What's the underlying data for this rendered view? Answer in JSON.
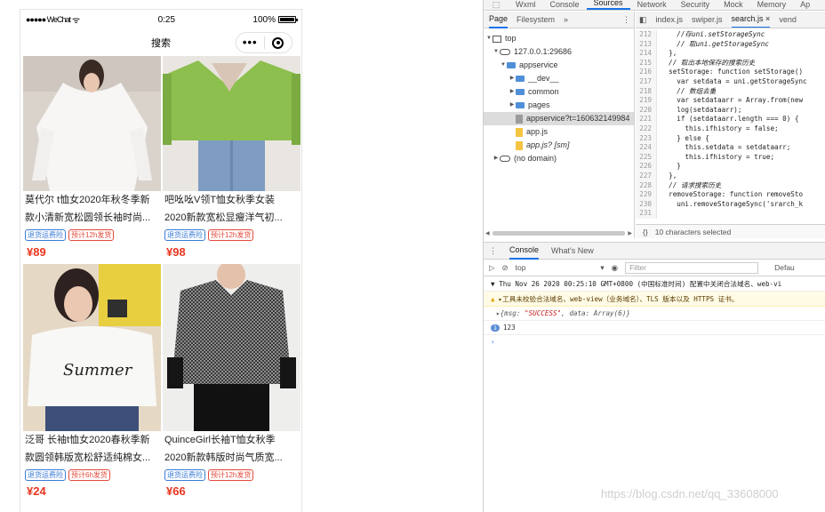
{
  "phone": {
    "status": {
      "carrier": "●●●●● WeChat",
      "wifi": "ᯤ",
      "time": "0:25",
      "battery_pct": "100%",
      "battery_level": 1.0
    },
    "nav_title": "搜索",
    "capsule_more": "•••",
    "products": [
      {
        "line1": "莫代尔 t恤女2020年秋冬季新",
        "line2": "款小清新宽松圆领长袖时尚...",
        "tag1": "退货运费险",
        "tag2": "预计12h发货",
        "price": "¥89",
        "image": "white-long-sleeve-tee"
      },
      {
        "line1": "吧吆吆V领T恤女秋季女装",
        "line2": "2020新款宽松显瘦洋气初...",
        "tag1": "退货运费险",
        "tag2": "预计12h发货",
        "price": "¥98",
        "image": "green-v-neck-top"
      },
      {
        "line1": "泛哥 长袖t恤女2020春秋季新",
        "line2": "款圆领韩版宽松舒适纯棉女...",
        "tag1": "退货运费险",
        "tag2": "预计6h发货",
        "price": "¥24",
        "image": "white-summer-sweatshirt"
      },
      {
        "line1": "QuinceGirl长袖T恤女秋季",
        "line2": "2020新款韩版时尚气质宽...",
        "tag1": "退货运费险",
        "tag2": "预计12h发货",
        "price": "¥66",
        "image": "houndstooth-top"
      }
    ]
  },
  "devtools": {
    "top_tabs": [
      "Wxml",
      "Console",
      "Sources",
      "Network",
      "Security",
      "Mock",
      "Memory",
      "Ap"
    ],
    "active_top_tab": "Sources",
    "nav_tabs": {
      "page": "Page",
      "filesystem": "Filesystem",
      "more": "»",
      "kebab": "⋮"
    },
    "tree": [
      {
        "label": "top",
        "depth": 0,
        "icon": "frame-icon",
        "expanded": true
      },
      {
        "label": "127.0.0.1:29686",
        "depth": 1,
        "icon": "cloud-icon",
        "expanded": true
      },
      {
        "label": "appservice",
        "depth": 2,
        "icon": "folder-icon",
        "expanded": true
      },
      {
        "label": "__dev__",
        "depth": 3,
        "icon": "folder-icon",
        "expanded": false
      },
      {
        "label": "common",
        "depth": 3,
        "icon": "folder-icon",
        "expanded": false
      },
      {
        "label": "pages",
        "depth": 3,
        "icon": "folder-icon",
        "expanded": false
      },
      {
        "label": "appservice?t=160632149984",
        "depth": 3,
        "icon": "file-icon",
        "selected": true
      },
      {
        "label": "app.js",
        "depth": 3,
        "icon": "js-file-icon"
      },
      {
        "label": "app.js? [sm]",
        "depth": 3,
        "icon": "js-file-icon"
      },
      {
        "label": "(no domain)",
        "depth": 0,
        "icon": "cloud-icon",
        "expanded": false
      }
    ],
    "editor_tabs": [
      "index.js",
      "swiper.js",
      "search.js ×",
      "vend"
    ],
    "active_editor_tab": "search.js ×",
    "code_lines": [
      {
        "n": "212",
        "t": "    //存uni.setStorageSync"
      },
      {
        "n": "213",
        "t": "    // 取uni.getStorageSync"
      },
      {
        "n": "214",
        "t": "  },"
      },
      {
        "n": "215",
        "t": "  // 取出本地保存的搜索历史"
      },
      {
        "n": "216",
        "t": "  setStorage: function setStorage()"
      },
      {
        "n": "217",
        "t": "    var setdata = uni.getStorageSync"
      },
      {
        "n": "218",
        "t": "    // 数组去重"
      },
      {
        "n": "219",
        "t": "    var setdataarr = Array.from(new"
      },
      {
        "n": "220",
        "t": "    log(setdataarr);"
      },
      {
        "n": "221",
        "t": "    if (setdataarr.length === 0) {"
      },
      {
        "n": "222",
        "t": "      this.ifhistory = false;"
      },
      {
        "n": "223",
        "t": "    } else {"
      },
      {
        "n": "224",
        "t": "      this.setdata = setdataarr;"
      },
      {
        "n": "225",
        "t": "      this.ifhistory = true;"
      },
      {
        "n": "226",
        "t": "    }"
      },
      {
        "n": "227",
        "t": "  },"
      },
      {
        "n": "228",
        "t": "  // 请求搜索历史"
      },
      {
        "n": "229",
        "t": "  removeStorage: function removeSto"
      },
      {
        "n": "230",
        "t": "    uni.removeStorageSync('srarch_k"
      },
      {
        "n": "231",
        "t": ""
      }
    ],
    "editor_status": {
      "braces": "{}",
      "selection": "10 characters selected"
    },
    "drawer_tabs": [
      "Console",
      "What's New"
    ],
    "console_context": "top",
    "filter_placeholder": "Filter",
    "levels": "Defau",
    "logs": {
      "group": "▼ Thu Nov 26 2020 00:25:10 GMT+0800 (中国标准时间) 配置中关闭合法域名、web-vi",
      "warn": "▸工具未校验合法域名、web-view（业务域名）、TLS 版本以及 HTTPS 证书。",
      "obj_prefix": "▸{msg: ",
      "obj_msg": "\"SUCCESS\"",
      "obj_suffix": ", data: Array(6)}",
      "info_badge": "1",
      "info_value": "123",
      "prompt": "›"
    }
  },
  "watermark": "https://blog.csdn.net/qq_33608000"
}
